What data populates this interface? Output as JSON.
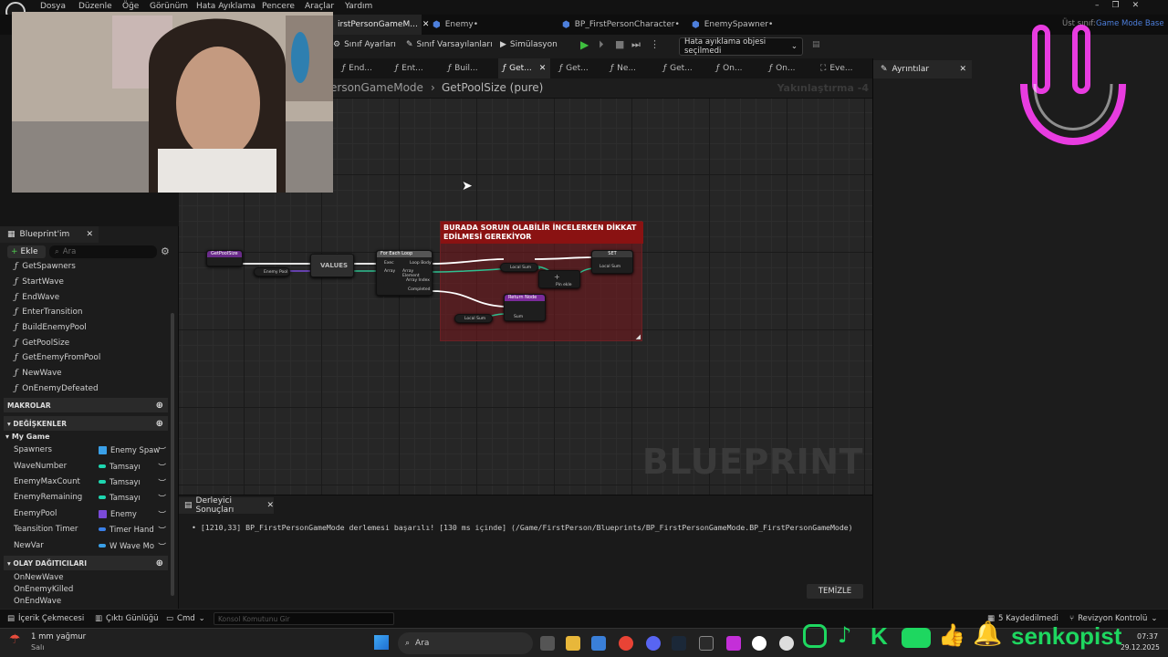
{
  "menubar": {
    "items": [
      "Dosya",
      "Düzenle",
      "Öğe",
      "Görünüm",
      "Hata Ayıklama",
      "Pencere",
      "Araçlar",
      "Yardım"
    ],
    "parent_class_label": "Üst sınıf:",
    "parent_class_value": "Game Mode Base"
  },
  "tabs": [
    {
      "label": "irstPersonGameM...",
      "active": true
    },
    {
      "label": "Enemy•",
      "active": false
    },
    {
      "label": "BP_FirstPersonCharacter•",
      "active": false
    },
    {
      "label": "EnemySpawner•",
      "active": false
    }
  ],
  "toolbar": {
    "class_settings": "Sınıf Ayarları",
    "class_defaults": "Sınıf Varsayılanları",
    "simulation": "Simülasyon",
    "debug_object": "Hata ayıklama objesi seçilmedi"
  },
  "function_tabs": [
    "End...",
    "Ent...",
    "Buil...",
    "Get...",
    "Get...",
    "Ne...",
    "Get...",
    "On...",
    "On...",
    "Eve..."
  ],
  "function_tabs_active_index": 3,
  "details": {
    "tab_label": "Ayrıntılar"
  },
  "breadcrumb": {
    "parent": "ersonGameMode",
    "current": "GetPoolSize (pure)",
    "zoom": "Yakınlaştırma -4"
  },
  "graph": {
    "watermark": "BLUEPRINT",
    "comment": "BURADA SORUN OLABİLİR İNCELERKEN DİKKAT EDİLMESİ GEREKİYOR",
    "nodes": {
      "entry": "GetPoolSize",
      "enemy_pool": "Enemy Pool",
      "values": "VALUES",
      "for_each": "For Each Loop",
      "for_each_pins": [
        "Exec",
        "Array",
        "Loop Body",
        "Array Element",
        "Array Index",
        "Completed"
      ],
      "local_sum": "Local Sum",
      "set": "SET",
      "set_pin": "Local Sum",
      "add_pin": "Pin ekle",
      "return_node": "Return Node",
      "return_pin": "Sum",
      "local_sum_2": "Local Sum"
    }
  },
  "compiler": {
    "tab_label": "Derleyici Sonuçları",
    "message": "[1210,33] BP_FirstPersonGameMode derlemesi başarılı! [130 ms içinde] (/Game/FirstPerson/Blueprints/BP_FirstPersonGameMode.BP_FirstPersonGameMode)",
    "clear_label": "TEMİZLE"
  },
  "left_panel": {
    "tab_label": "Blueprint'im",
    "add_label": "Ekle",
    "search_placeholder": "Ara",
    "functions": [
      "GetSpawners",
      "StartWave",
      "EndWave",
      "EnterTransition",
      "BuildEnemyPool",
      "GetPoolSize",
      "GetEnemyFromPool",
      "NewWave",
      "OnEnemyDefeated"
    ],
    "macros_label": "MAKROLAR",
    "variables_label": "DEĞİŞKENLER",
    "my_game_label": "My Game",
    "variables": [
      {
        "name": "Spawners",
        "type": "Enemy Spaw",
        "color": "#3aa0e8"
      },
      {
        "name": "WaveNumber",
        "type": "Tamsayı",
        "color": "#1ed6b0"
      },
      {
        "name": "EnemyMaxCount",
        "type": "Tamsayı",
        "color": "#1ed6b0"
      },
      {
        "name": "EnemyRemaining",
        "type": "Tamsayı",
        "color": "#1ed6b0"
      },
      {
        "name": "EnemyPool",
        "type": "Enemy",
        "color": "#7a4ad8"
      },
      {
        "name": "Teansition Timer",
        "type": "Timer Hand",
        "color": "#3a80e8"
      },
      {
        "name": "NewVar",
        "type": "W Wave Mo",
        "color": "#3aa0e8"
      }
    ],
    "dispatchers_label": "OLAY DAĞITICILARI",
    "dispatchers": [
      "OnNewWave",
      "OnEnemyKilled",
      "OnEndWave"
    ]
  },
  "statusbar": {
    "content_drawer": "İçerik Çekmecesi",
    "output_log": "Çıktı Günlüğü",
    "cmd": "Cmd",
    "console_placeholder": "Konsol Komutunu Gir",
    "saved": "5 Kaydedilmedi",
    "revision": "Revizyon Kontrolü"
  },
  "taskbar": {
    "weather": "1 mm yağmur",
    "day": "Salı",
    "search": "Ara",
    "time": "07:37",
    "date": "29.12.2025"
  },
  "overlay": {
    "brand": "senkopist"
  },
  "colors": {
    "accent": "#4d7fdc",
    "brand": "#1ed760",
    "smiley": "#e83ce0",
    "comment": "#8a1212"
  }
}
